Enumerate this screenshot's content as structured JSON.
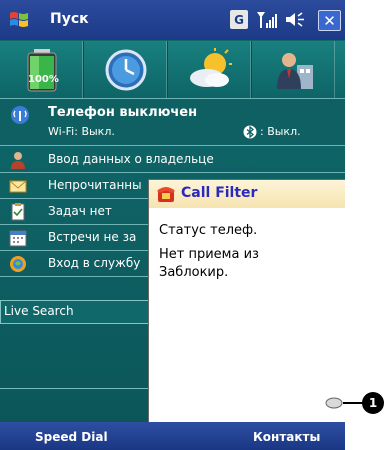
{
  "titlebar": {
    "title": "Пуск",
    "gprs_badge": "G",
    "close_label": "✕"
  },
  "icon_row": {
    "battery_label": "100%",
    "items": [
      "battery-icon",
      "clock-icon",
      "weather-icon",
      "owner-icon"
    ]
  },
  "phone_status": {
    "title": "Телефон выключен",
    "wifi": "Wi-Fi: Выкл.",
    "bluetooth": ": Выкл."
  },
  "list": [
    {
      "icon": "person-icon",
      "label": "Ввод данных о владельце"
    },
    {
      "icon": "envelope-icon",
      "label": "Непрочитанны"
    },
    {
      "icon": "task-icon",
      "label": "Задач нет"
    },
    {
      "icon": "calendar-icon",
      "label": "Встречи не за"
    },
    {
      "icon": "windows-live-icon",
      "label": "Вход в службу"
    }
  ],
  "live_search": "Live Search",
  "popup": {
    "title": "Call Filter",
    "line1": "Статус телеф.",
    "line2": "Нет приема из",
    "line3": "Заблокир."
  },
  "softkeys": {
    "left": "Speed Dial",
    "right": "Контакты"
  },
  "callout": {
    "number": "1"
  }
}
